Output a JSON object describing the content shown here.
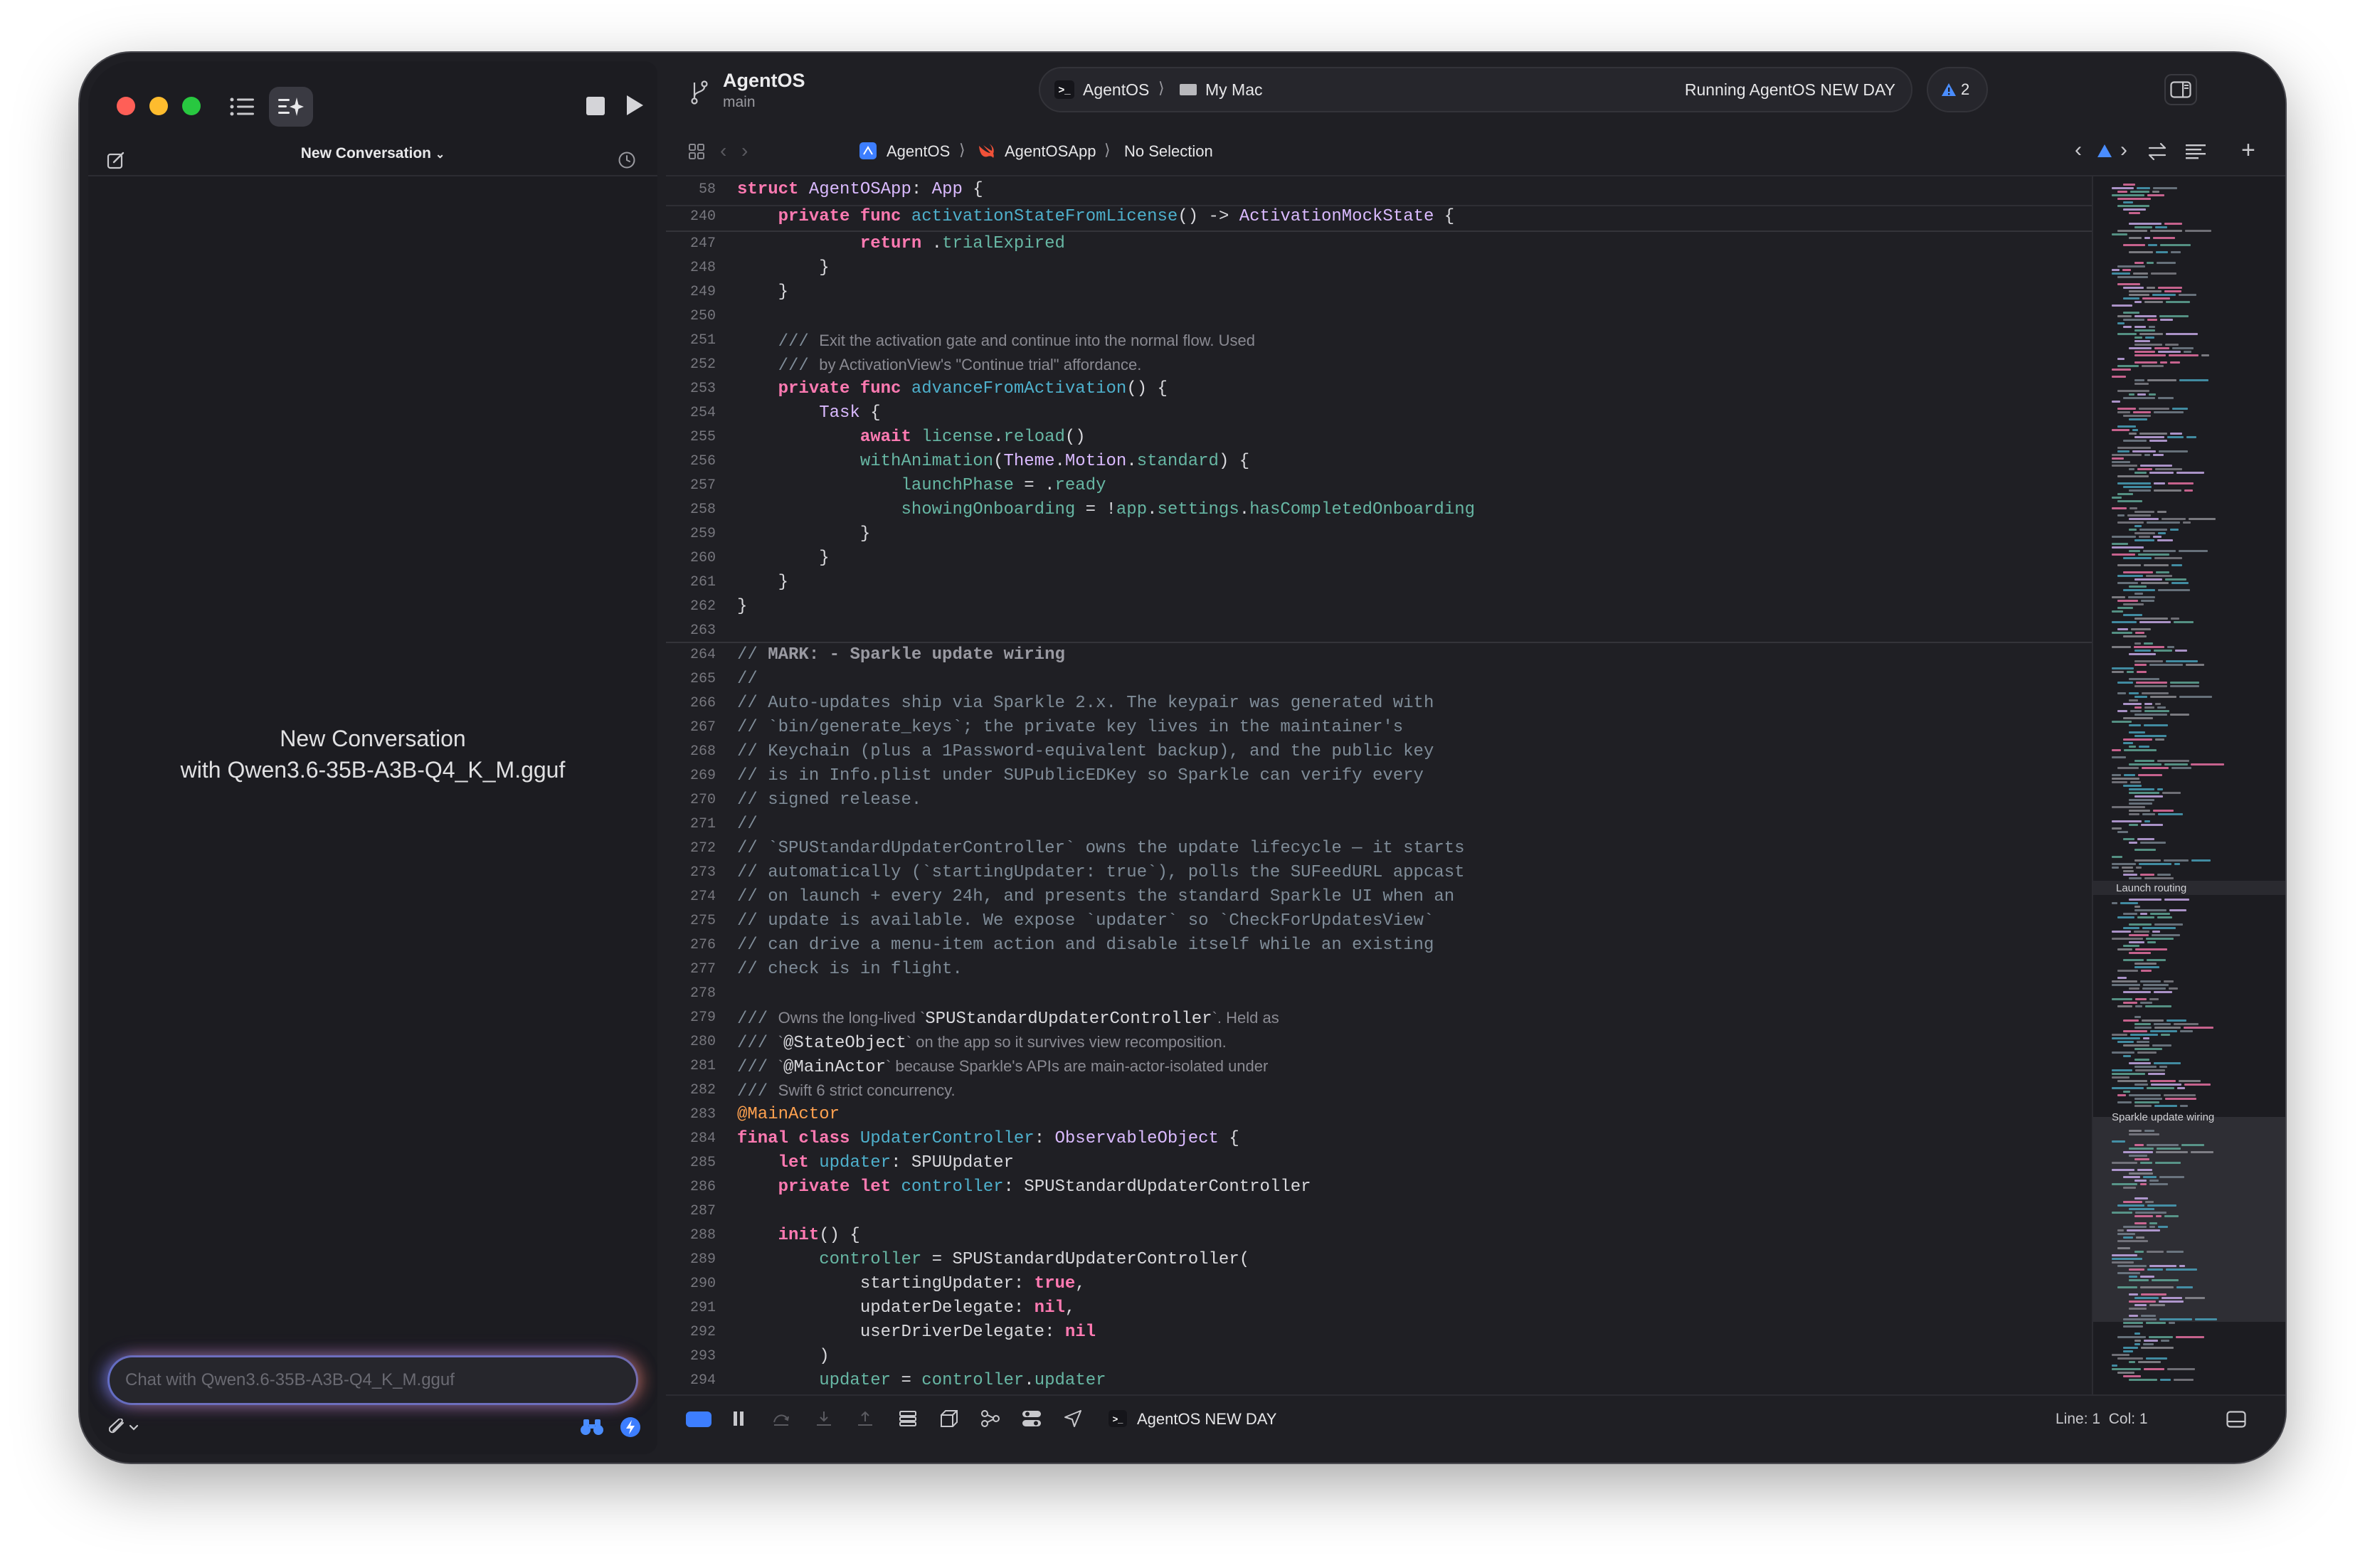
{
  "left_panel": {
    "toolbar_title": "New Conversation",
    "empty_state_line1": "New Conversation",
    "empty_state_line2": "with Qwen3.6-35B-A3B-Q4_K_M.gguf",
    "chat_placeholder": "Chat with Qwen3.6-35B-A3B-Q4_K_M.gguf"
  },
  "title_bar": {
    "project_name": "AgentOS",
    "branch": "main",
    "scheme": "AgentOS",
    "destination": "My Mac",
    "status": "Running AgentOS NEW DAY",
    "warning_count": "2"
  },
  "jump_bar": {
    "crumbs": [
      "AgentOS",
      "AgentOSApp",
      "No Selection"
    ]
  },
  "editor": {
    "sticky": [
      {
        "ln": "58",
        "html": "<span class='k'>struct</span> <span class='t'>AgentOSApp</span>: <span class='t'>App</span> {"
      },
      {
        "ln": "240",
        "html": "    <span class='k'>private</span> <span class='k'>func</span> <span class='p'>activationStateFromLicense</span>() -> <span class='t'>ActivationMockState</span> {"
      }
    ],
    "lines": [
      {
        "ln": "247",
        "html": "            <span class='k'>return</span> .<span class='f'>trialExpired</span>"
      },
      {
        "ln": "248",
        "html": "        }"
      },
      {
        "ln": "249",
        "html": "    }"
      },
      {
        "ln": "250",
        "html": ""
      },
      {
        "ln": "251",
        "html": "    <span class='c'>///</span> <span class='dc'>Exit the activation gate and continue into the normal flow. Used</span>"
      },
      {
        "ln": "252",
        "html": "    <span class='c'>///</span> <span class='dc'>by ActivationView's \"Continue trial\" affordance.</span>"
      },
      {
        "ln": "253",
        "html": "    <span class='k'>private</span> <span class='k'>func</span> <span class='p'>advanceFromActivation</span>() {"
      },
      {
        "ln": "254",
        "html": "        <span class='t'>Task</span> {"
      },
      {
        "ln": "255",
        "html": "            <span class='k'>await</span> <span class='f'>license</span>.<span class='f'>reload</span>()"
      },
      {
        "ln": "256",
        "html": "            <span class='f'>withAnimation</span>(<span class='t'>Theme</span>.<span class='t'>Motion</span>.<span class='f'>standard</span>) {"
      },
      {
        "ln": "257",
        "html": "                <span class='f'>launchPhase</span> = .<span class='f'>ready</span>"
      },
      {
        "ln": "258",
        "html": "                <span class='f'>showingOnboarding</span> = !<span class='f'>app</span>.<span class='f'>settings</span>.<span class='f'>hasCompletedOnboarding</span>"
      },
      {
        "ln": "259",
        "html": "            }"
      },
      {
        "ln": "260",
        "html": "        }"
      },
      {
        "ln": "261",
        "html": "    }"
      },
      {
        "ln": "262",
        "html": "}"
      },
      {
        "ln": "263",
        "html": ""
      },
      {
        "ln": "264",
        "html": "<span class='c'>// </span><span class='cb'>MARK: - Sparkle update wiring</span>"
      },
      {
        "ln": "265",
        "html": "<span class='c'>//</span>"
      },
      {
        "ln": "266",
        "html": "<span class='c'>// Auto-updates ship via Sparkle 2.x. The keypair was generated with</span>"
      },
      {
        "ln": "267",
        "html": "<span class='c'>// `bin/generate_keys`; the private key lives in the maintainer's</span>"
      },
      {
        "ln": "268",
        "html": "<span class='c'>// Keychain (plus a 1Password-equivalent backup), and the public key</span>"
      },
      {
        "ln": "269",
        "html": "<span class='c'>// is in Info.plist under SUPublicEDKey so Sparkle can verify every</span>"
      },
      {
        "ln": "270",
        "html": "<span class='c'>// signed release.</span>"
      },
      {
        "ln": "271",
        "html": "<span class='c'>//</span>"
      },
      {
        "ln": "272",
        "html": "<span class='c'>// `SPUStandardUpdaterController` owns the update lifecycle — it starts</span>"
      },
      {
        "ln": "273",
        "html": "<span class='c'>// automatically (`startingUpdater: true`), polls the SUFeedURL appcast</span>"
      },
      {
        "ln": "274",
        "html": "<span class='c'>// on launch + every 24h, and presents the standard Sparkle UI when an</span>"
      },
      {
        "ln": "275",
        "html": "<span class='c'>// update is available. We expose `updater` so `CheckForUpdatesView`</span>"
      },
      {
        "ln": "276",
        "html": "<span class='c'>// can drive a menu-item action and disable itself while an existing</span>"
      },
      {
        "ln": "277",
        "html": "<span class='c'>// check is in flight.</span>"
      },
      {
        "ln": "278",
        "html": ""
      },
      {
        "ln": "279",
        "html": "<span class='c'>///</span> <span class='dc'>Owns the long-lived `</span><span class='dcm'>SPUStandardUpdaterController</span><span class='dc'>`. Held as</span>"
      },
      {
        "ln": "280",
        "html": "<span class='c'>///</span> <span class='dc'>`</span><span class='dcm'>@StateObject</span><span class='dc'>` on the app so it survives view recomposition.</span>"
      },
      {
        "ln": "281",
        "html": "<span class='c'>///</span> <span class='dc'>`</span><span class='dcm'>@MainActor</span><span class='dc'>` because Sparkle's APIs are main-actor-isolated under</span>"
      },
      {
        "ln": "282",
        "html": "<span class='c'>///</span> <span class='dc'>Swift 6 strict concurrency.</span>"
      },
      {
        "ln": "283",
        "html": "<span class='a'>@MainActor</span>"
      },
      {
        "ln": "284",
        "html": "<span class='k'>final</span> <span class='k'>class</span> <span class='p'>UpdaterController</span>: <span class='t'>ObservableObject</span> {"
      },
      {
        "ln": "285",
        "html": "    <span class='k'>let</span> <span class='p'>updater</span>: SPUUpdater"
      },
      {
        "ln": "286",
        "html": "    <span class='k'>private</span> <span class='k'>let</span> <span class='p'>controller</span>: SPUStandardUpdaterController"
      },
      {
        "ln": "287",
        "html": ""
      },
      {
        "ln": "288",
        "html": "    <span class='k'>init</span>() {"
      },
      {
        "ln": "289",
        "html": "        <span class='f'>controller</span> = SPUStandardUpdaterController("
      },
      {
        "ln": "290",
        "html": "            startingUpdater: <span class='k'>true</span>,"
      },
      {
        "ln": "291",
        "html": "            updaterDelegate: <span class='k'>nil</span>,"
      },
      {
        "ln": "292",
        "html": "            userDriverDelegate: <span class='k'>nil</span>"
      },
      {
        "ln": "293",
        "html": "        )"
      },
      {
        "ln": "294",
        "html": "        <span class='f'>updater</span> = <span class='f'>controller</span>.<span class='f'>updater</span>"
      }
    ]
  },
  "minimap": {
    "labels": [
      "Launch routing",
      "Sparkle update wiring"
    ]
  },
  "debug_bar": {
    "process": "AgentOS NEW DAY",
    "cursor": "Line: 1  Col: 1"
  },
  "colors": {
    "keyword": "#ff7ab2",
    "type": "#dabaff",
    "property": "#67b7a4",
    "declaration": "#4eb0cc",
    "comment": "#7f8c98",
    "attribute": "#ffa14f",
    "accent": "#3d7eff"
  }
}
